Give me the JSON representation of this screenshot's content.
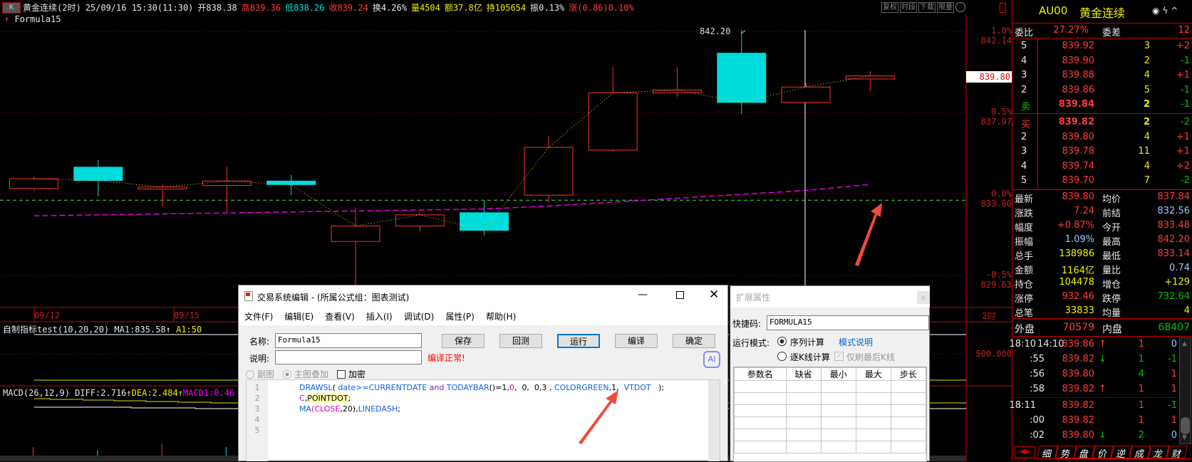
{
  "header": {
    "k_label": "K",
    "title": "黄金连续(2时)",
    "datetime": "25/09/16 15:30(11:30)",
    "open": "开838.38",
    "high": "高839.36",
    "low": "低838.26",
    "close": "收839.24",
    "turnover": "换4.26%",
    "volume": "量4504",
    "amount": "额37.8亿",
    "hold": "持105654",
    "amplitude": "振0.13%",
    "change": "涨(0.86)0.10%",
    "buttons": [
      "复权",
      "时段",
      "下载",
      "限量"
    ]
  },
  "formula_label": "Formula15",
  "price_axis": {
    "labels": [
      {
        "pct": "1.0%",
        "price": "842.14"
      },
      {
        "pct": "0.5%",
        "price": "837.97"
      },
      {
        "pct": "0.0%",
        "price": "833.80"
      },
      {
        "pct": "-0.5%",
        "price": "829.63"
      }
    ],
    "current_marker": "839.80",
    "indicator_level": "500.000",
    "period": "2时"
  },
  "chart_data": {
    "type": "candlestick",
    "high_label": "842.20",
    "dates": [
      "09/12",
      "09/15"
    ],
    "candles": [
      {
        "o": 834.1,
        "h": 834.7,
        "l": 834.0,
        "c": 834.6
      },
      {
        "o": 835.19,
        "h": 835.57,
        "l": 833.7,
        "c": 834.51
      },
      {
        "o": 834.07,
        "h": 834.3,
        "l": 833.2,
        "c": 834.17
      },
      {
        "o": 834.25,
        "h": 835.2,
        "l": 832.9,
        "c": 834.48
      },
      {
        "o": 834.48,
        "h": 834.8,
        "l": 833.76,
        "c": 834.3
      },
      {
        "o": 831.39,
        "h": 833.1,
        "l": 828.6,
        "c": 832.18
      },
      {
        "o": 832.18,
        "h": 832.9,
        "l": 831.9,
        "c": 832.75
      },
      {
        "o": 832.86,
        "h": 833.5,
        "l": 831.7,
        "c": 831.96
      },
      {
        "o": 833.76,
        "h": 836.77,
        "l": 833.4,
        "c": 836.2
      },
      {
        "o": 836.06,
        "h": 840.3,
        "l": 836.0,
        "c": 838.99
      },
      {
        "o": 838.99,
        "h": 840.3,
        "l": 838.8,
        "c": 839.14
      },
      {
        "o": 841.02,
        "h": 842.2,
        "l": 837.9,
        "c": 838.5
      },
      {
        "o": 838.5,
        "h": 839.5,
        "l": 838.5,
        "c": 839.29
      },
      {
        "o": 839.7,
        "h": 840.1,
        "l": 839.1,
        "c": 839.86
      }
    ],
    "ma20": [
      832.7,
      832.75,
      832.8,
      832.85,
      832.9,
      832.95,
      833.0,
      833.05,
      833.2,
      833.4,
      833.6,
      833.8,
      834.0,
      834.3
    ],
    "drawsl_level": 833.5,
    "macd_bars": [
      3,
      -2,
      4,
      -3,
      5,
      2,
      -4,
      3,
      6,
      5,
      -3,
      4,
      2,
      5
    ]
  },
  "indicator": {
    "title": "自制指标test(10,20,20)",
    "ma1": "MA1:835.58",
    "a1": "A1:50"
  },
  "macd": {
    "title": "MACD(26,12,9)",
    "diff": "DIFF:2.716",
    "dea": "DEA:2.484",
    "macd1": "MACD1:0.46"
  },
  "quote": {
    "code": "AU00",
    "name": "黄金连续",
    "weibi_label": "委比",
    "weibi": "27.27%",
    "weicha_label": "委差",
    "weicha": "12",
    "asks": [
      {
        "lvl": "5",
        "price": "839.92",
        "vol": "3",
        "chg": "+2"
      },
      {
        "lvl": "4",
        "price": "839.90",
        "vol": "2",
        "chg": "-1"
      },
      {
        "lvl": "3",
        "price": "839.88",
        "vol": "4",
        "chg": "+1"
      },
      {
        "lvl": "2",
        "price": "839.86",
        "vol": "5",
        "chg": "-1"
      },
      {
        "lvl": "卖",
        "price": "839.84",
        "vol": "2",
        "chg": "-1"
      }
    ],
    "bids": [
      {
        "lvl": "买",
        "price": "839.82",
        "vol": "2",
        "chg": "-2"
      },
      {
        "lvl": "2",
        "price": "839.80",
        "vol": "4",
        "chg": "+1"
      },
      {
        "lvl": "3",
        "price": "839.78",
        "vol": "11",
        "chg": "+1"
      },
      {
        "lvl": "4",
        "price": "839.74",
        "vol": "4",
        "chg": "+2"
      },
      {
        "lvl": "5",
        "price": "839.70",
        "vol": "7",
        "chg": "-2"
      }
    ],
    "stats": [
      {
        "l1": "最新",
        "v1": "839.80",
        "c1": "r",
        "l2": "均价",
        "v2": "837.84",
        "c2": "r"
      },
      {
        "l1": "涨跌",
        "v1": "7.24",
        "c1": "r",
        "l2": "前结",
        "v2": "832.56",
        "c2": "b"
      },
      {
        "l1": "幅度",
        "v1": "+0.87%",
        "c1": "r",
        "l2": "今开",
        "v2": "833.48",
        "c2": "r"
      },
      {
        "l1": "振幅",
        "v1": "1.09%",
        "c1": "b",
        "l2": "最高",
        "v2": "842.20",
        "c2": "r"
      },
      {
        "l1": "总手",
        "v1": "138986",
        "c1": "y",
        "l2": "最低",
        "v2": "833.14",
        "c2": "r"
      },
      {
        "l1": "金额",
        "v1": "1164亿",
        "c1": "y",
        "l2": "量比",
        "v2": "0.74",
        "c2": "b"
      },
      {
        "l1": "持仓",
        "v1": "104478",
        "c1": "y",
        "l2": "增仓",
        "v2": "+129",
        "c2": "y"
      },
      {
        "l1": "涨停",
        "v1": "932.46",
        "c1": "r",
        "l2": "跌停",
        "v2": "732.64",
        "c2": "g"
      },
      {
        "l1": "总笔",
        "v1": "33833",
        "c1": "y",
        "l2": "均量",
        "v2": "4",
        "c2": "y"
      }
    ],
    "outer_label": "外盘",
    "outer": "70579",
    "inner_label": "内盘",
    "inner": "68407",
    "ticks": [
      {
        "t": "18:10",
        "t2": "14:10",
        "p": "839.86",
        "a": "↑",
        "ac": "r",
        "v": "1",
        "vc": "r",
        "d": "0",
        "dc": "b"
      },
      {
        "t": ":55",
        "t2": "",
        "p": "839.82",
        "a": "↓",
        "ac": "g",
        "v": "1",
        "vc": "g",
        "d": "-1",
        "dc": "g"
      },
      {
        "t": ":56",
        "t2": "",
        "p": "839.80",
        "a": "",
        "ac": "r",
        "v": "4",
        "vc": "g",
        "d": "1",
        "dc": "r"
      },
      {
        "t": ":58",
        "t2": "",
        "p": "839.82",
        "a": "↑",
        "ac": "r",
        "v": "1",
        "vc": "r",
        "d": "1",
        "dc": "r"
      },
      {
        "t": "18:11",
        "t2": "",
        "p": "839.82",
        "a": "",
        "ac": "r",
        "v": "1",
        "vc": "r",
        "d": "-1",
        "dc": "g"
      },
      {
        "t": ":00",
        "t2": "",
        "p": "839.82",
        "a": "",
        "ac": "r",
        "v": "1",
        "vc": "r",
        "d": "1",
        "dc": "r"
      },
      {
        "t": ":02",
        "t2": "",
        "p": "839.80",
        "a": "↓",
        "ac": "g",
        "v": "2",
        "vc": "g",
        "d": "0",
        "dc": "b"
      }
    ],
    "tabs": [
      "细",
      "势",
      "盘",
      "价",
      "逆",
      "成",
      "龙",
      "财"
    ]
  },
  "editor": {
    "title": "交易系统编辑 - (所属公式组：图表测试)",
    "menu": [
      "文件(F)",
      "编辑(E)",
      "查看(V)",
      "插入(I)",
      "调试(D)",
      "属性(P)",
      "帮助(H)"
    ],
    "name_label": "名称:",
    "name_value": "Formula15",
    "desc_label": "说明:",
    "desc_value": "",
    "status": "编译正常!",
    "buttons": {
      "save": "保存",
      "backtest": "回测",
      "run": "运行",
      "compile": "编译",
      "ok": "确定"
    },
    "radio_sub": "副图",
    "radio_main": "主图叠加",
    "encrypt": "加密",
    "ai": "AI",
    "line_numbers": [
      "1",
      "2",
      "3",
      "4",
      "5"
    ],
    "code": [
      [
        {
          "t": "DRAWSL",
          "k": "blue"
        },
        {
          "t": "( ",
          "k": "blk"
        },
        {
          "t": "date",
          "k": "blue"
        },
        {
          "t": ">=CURRENTDATE ",
          "k": "blue"
        },
        {
          "t": "and ",
          "k": "pur"
        },
        {
          "t": "TODAYBAR",
          "k": "blue"
        },
        {
          "t": "()=1,",
          "k": "blk"
        },
        {
          "t": "0",
          "k": "mag"
        },
        {
          "t": ",  0,  0,3 , ",
          "k": "blk"
        },
        {
          "t": "COLORGREEN",
          "k": "blue"
        },
        {
          "t": ",1,  ",
          "k": "blk"
        },
        {
          "t": "VTDOT",
          "k": "blue"
        },
        {
          "t": "   );",
          "k": "blk"
        }
      ],
      [
        {
          "t": "C",
          "k": "mag"
        },
        {
          "t": ",",
          "k": "blk"
        },
        {
          "t": "POINTDOT",
          "k": "hl"
        },
        {
          "t": ";",
          "k": "blk"
        }
      ],
      [
        {
          "t": "MA",
          "k": "blue"
        },
        {
          "t": "(",
          "k": "mag"
        },
        {
          "t": "CLOSE",
          "k": "mag"
        },
        {
          "t": ",20),",
          "k": "blk"
        },
        {
          "t": "LINEDASH",
          "k": "blue"
        },
        {
          "t": ";",
          "k": "blk"
        }
      ]
    ]
  },
  "ext": {
    "title": "扩展属性",
    "shortcut_label": "快捷码:",
    "shortcut": "FORMULA15",
    "mode_label": "运行模式:",
    "mode_seq": "序列计算",
    "mode_link": "模式说明",
    "mode_bar": "逐K线计算",
    "refresh_last": "仅刷最后K线",
    "columns": [
      "参数名",
      "缺省",
      "最小",
      "最大",
      "步长"
    ]
  }
}
